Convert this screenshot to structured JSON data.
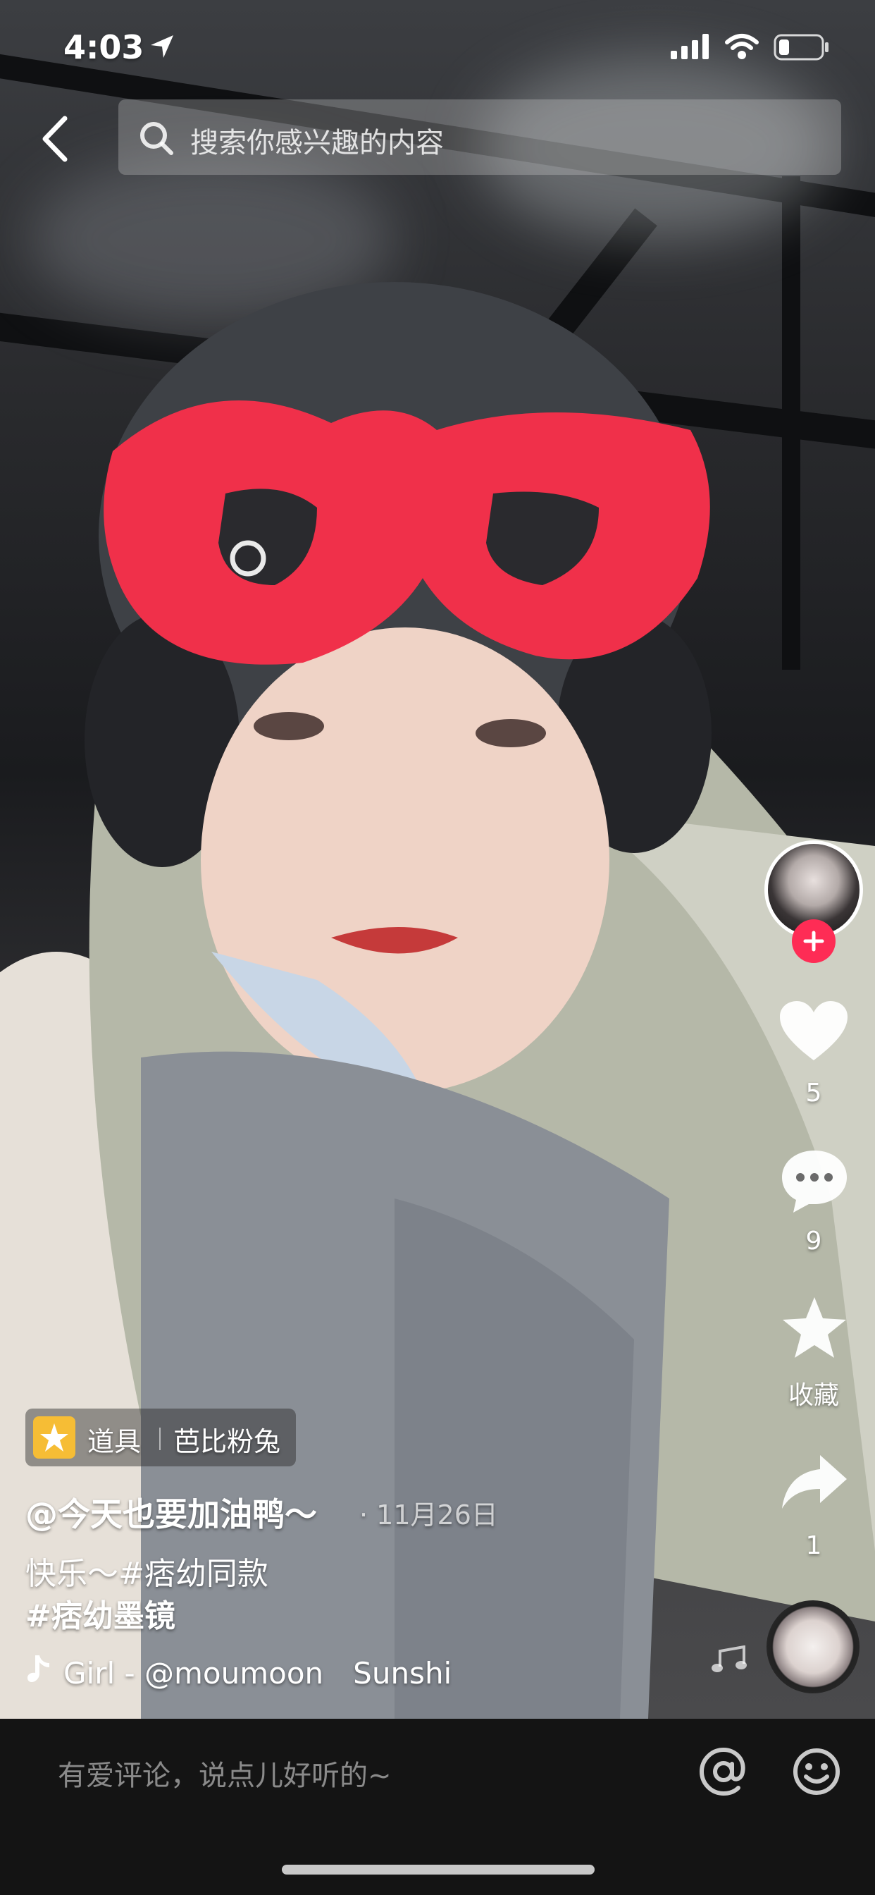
{
  "status_bar": {
    "time": "4:03"
  },
  "search": {
    "placeholder": "搜索你感兴趣的内容"
  },
  "video": {
    "prop": {
      "label": "道具",
      "name": "芭比粉兔"
    },
    "author": "@今天也要加油鸭～",
    "date": "· 11月26日",
    "description_line1": "快乐～#痞幼同款",
    "description_line2": "#痞幼墨镜",
    "music": "Girl - @moumoon　Sunshi"
  },
  "actions": {
    "likes": "5",
    "comments": "9",
    "favorite_label": "收藏",
    "shares": "1"
  },
  "comment_bar": {
    "placeholder": "有爱评论，说点儿好听的~"
  },
  "colors": {
    "accent_red": "#fe2c55",
    "prop_yellow": "#f6bd35"
  }
}
